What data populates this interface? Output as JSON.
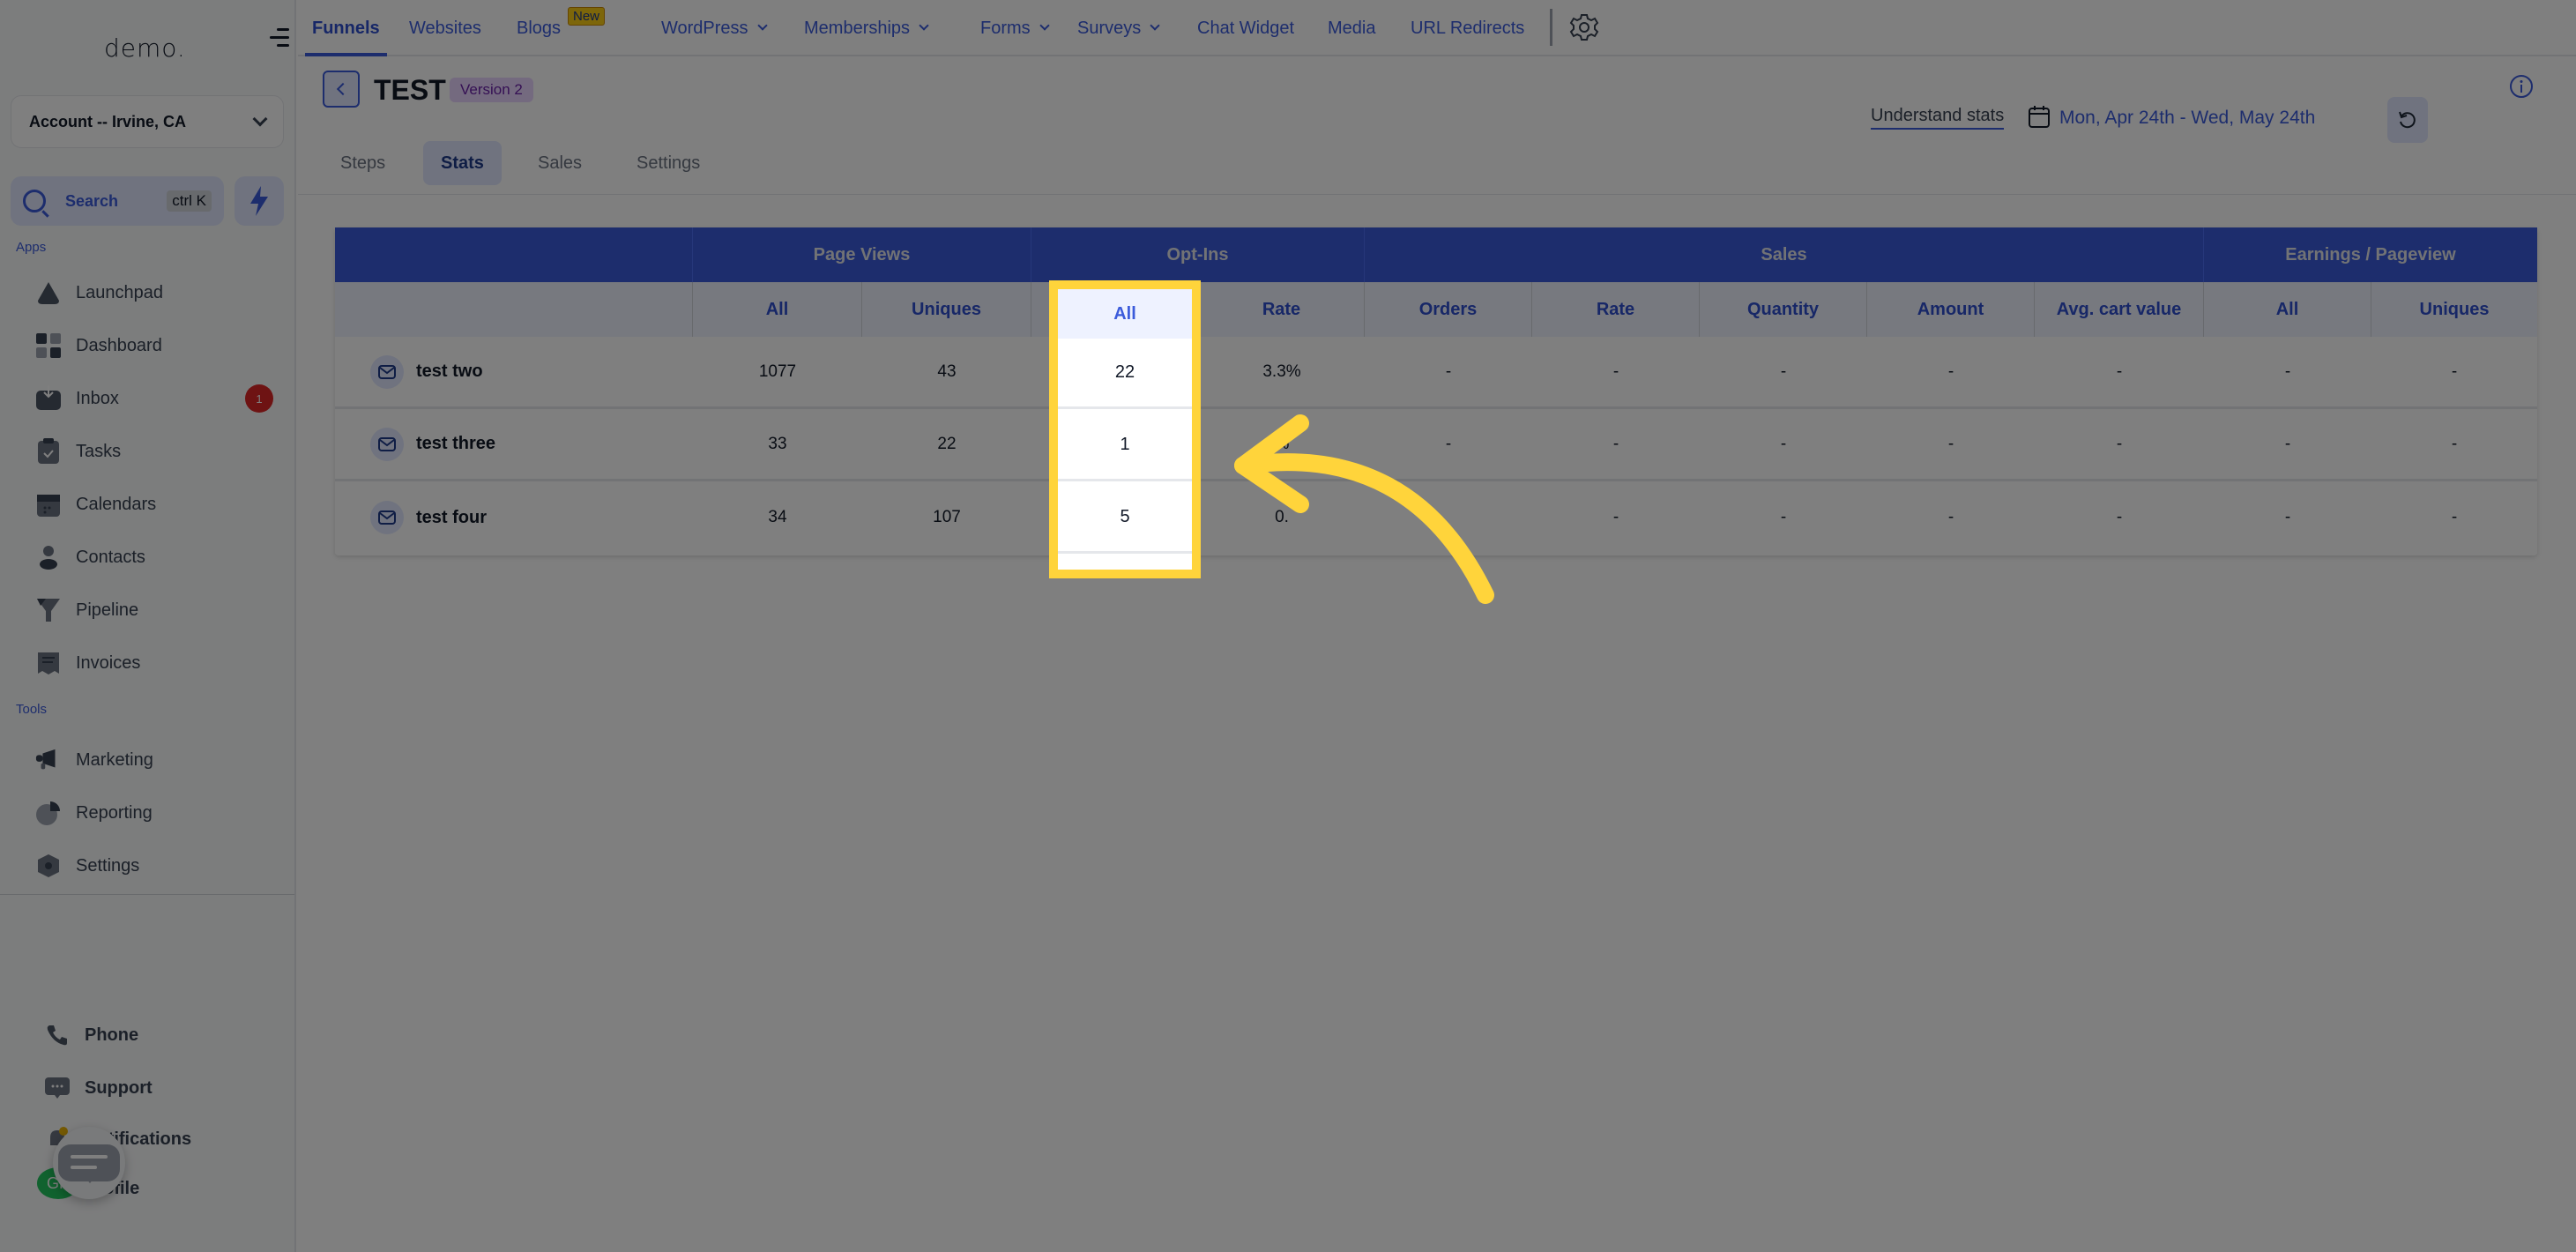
{
  "sidebar": {
    "logo": "demo.",
    "account": "Account -- Irvine, CA",
    "search_label": "Search",
    "search_shortcut": "ctrl K",
    "apps_label": "Apps",
    "tools_label": "Tools",
    "apps": [
      {
        "label": "Launchpad",
        "icon": "rocket-icon"
      },
      {
        "label": "Dashboard",
        "icon": "grid-icon"
      },
      {
        "label": "Inbox",
        "icon": "inbox-icon",
        "badge": "1"
      },
      {
        "label": "Tasks",
        "icon": "clipboard-check-icon"
      },
      {
        "label": "Calendars",
        "icon": "calendar-icon"
      },
      {
        "label": "Contacts",
        "icon": "person-icon"
      },
      {
        "label": "Pipeline",
        "icon": "funnel-icon"
      },
      {
        "label": "Invoices",
        "icon": "receipt-icon"
      }
    ],
    "tools": [
      {
        "label": "Marketing",
        "icon": "megaphone-icon"
      },
      {
        "label": "Reporting",
        "icon": "pie-chart-icon"
      },
      {
        "label": "Settings",
        "icon": "settings-hex-icon"
      }
    ],
    "bottom": [
      {
        "label": "Phone",
        "icon": "phone-icon"
      },
      {
        "label": "Support",
        "icon": "support-chat-icon"
      },
      {
        "label": "Notifications",
        "icon": "bell-icon"
      },
      {
        "label": "Profile",
        "icon": "avatar"
      }
    ],
    "avatar_initials": "GP"
  },
  "topnav": {
    "items": [
      {
        "label": "Funnels",
        "active": true
      },
      {
        "label": "Websites"
      },
      {
        "label": "Blogs",
        "badge": "New"
      },
      {
        "label": "WordPress",
        "dropdown": true
      },
      {
        "label": "Memberships",
        "dropdown": true
      },
      {
        "label": "Forms",
        "dropdown": true
      },
      {
        "label": "Surveys",
        "dropdown": true
      },
      {
        "label": "Chat Widget"
      },
      {
        "label": "Media"
      },
      {
        "label": "URL Redirects"
      }
    ]
  },
  "header": {
    "title": "TEST",
    "version": "Version 2",
    "tabs": [
      "Steps",
      "Stats",
      "Sales",
      "Settings"
    ],
    "active_tab": "Stats",
    "understand_stats": "Understand stats",
    "date_range": "Mon, Apr 24th - Wed, May 24th"
  },
  "table": {
    "groups": [
      "",
      "Page Views",
      "Opt-Ins",
      "Sales",
      "Earnings / Pageview"
    ],
    "columns": [
      "",
      "All",
      "Uniques",
      "All",
      "Rate",
      "Orders",
      "Rate",
      "Quantity",
      "Amount",
      "Avg. cart value",
      "All",
      "Uniques"
    ],
    "rows": [
      {
        "name": "test two",
        "values": [
          "1077",
          "43",
          "22",
          "3.3%",
          "-",
          "-",
          "-",
          "-",
          "-",
          "-",
          "-"
        ]
      },
      {
        "name": "test three",
        "values": [
          "33",
          "22",
          "1",
          "%",
          "-",
          "-",
          "-",
          "-",
          "-",
          "-",
          "-"
        ]
      },
      {
        "name": "test four",
        "values": [
          "34",
          "107",
          "5",
          "0.",
          "",
          "-",
          "-",
          "-",
          "-",
          "-",
          "-"
        ]
      }
    ]
  },
  "annotation": {
    "highlighted_column": "Opt-Ins / All",
    "highlight_color": "#ffd43b"
  }
}
